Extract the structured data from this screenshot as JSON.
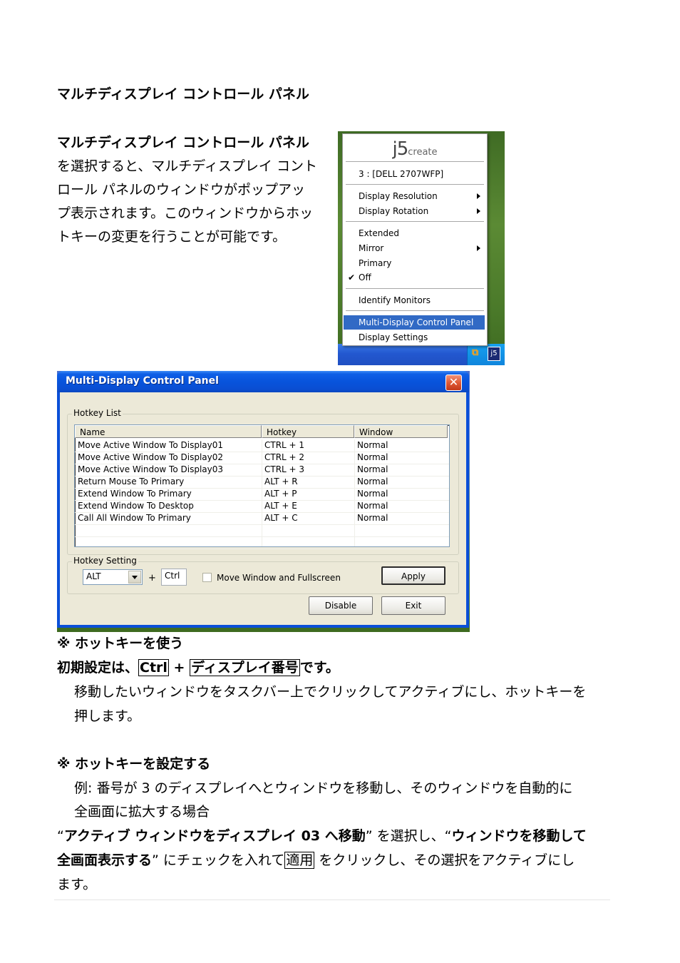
{
  "document": {
    "heading": "マルチディスプレイ コントロール パネル",
    "intro": {
      "bold_lead": "マルチディスプレイ コントロール パネル",
      "lines": [
        "を選択すると、マルチディスプレイ コント",
        "ロール パネルのウィンドウがポップアッ",
        "プ表示されます。このウィンドウからホッ",
        "トキーの変更を行うことが可能です。"
      ]
    },
    "section_use": {
      "title": "※ ホットキーを使う",
      "default_prefix": "初期設定は、",
      "default_key1": "Ctrl",
      "default_plus": " + ",
      "default_key2": "ディスプレイ番号",
      "default_suffix": "です。",
      "body_lines": [
        "移動したいウィンドウをタスクバー上でクリックしてアクティブにし、ホットキーを",
        "押します。"
      ]
    },
    "section_set": {
      "title": "※ ホットキーを設定する",
      "example_lines": [
        "例: 番号が 3 のディスプレイへとウィンドウを移動し、そのウィンドウを自動的に",
        "全画面に拡大する場合"
      ],
      "q1_open": "“",
      "q1_bold": "アクティブ ウィンドウをディスプレイ 03 へ移動",
      "q1_close": "” を選択し、“",
      "q2_bold_a": "ウィンドウを移動して",
      "q2_bold_b": "全画面表示する",
      "q2_close": "” にチェックを入れて",
      "apply_boxed": "適用",
      "after_apply": " をクリックし、その選択をアクティブにし",
      "last_line": "ます。"
    }
  },
  "context_menu": {
    "logo_main": "j5",
    "logo_sub": "create",
    "monitor": "3 : [DELL 2707WFP]",
    "items": [
      {
        "label": "Display Resolution",
        "submenu": true
      },
      {
        "label": "Display Rotation",
        "submenu": true
      },
      {
        "label": "Extended",
        "submenu": false
      },
      {
        "label": "Mirror",
        "submenu": true
      },
      {
        "label": "Primary",
        "submenu": false
      },
      {
        "label": "Off",
        "checked": true
      },
      {
        "label": "Identify Monitors"
      },
      {
        "label": "Multi-Display Control Panel",
        "selected": true
      },
      {
        "label": "Display Settings"
      }
    ],
    "tray_icons": [
      "office-icon",
      "j5-monitor-icon"
    ],
    "selection_color": "#316ac5"
  },
  "dialog": {
    "title": "Multi-Display Control Panel",
    "close_glyph": "✕",
    "hotkey_list": {
      "group_label": "Hotkey List",
      "columns": [
        "Name",
        "Hotkey",
        "Window"
      ],
      "rows": [
        [
          "Move Active Window To Display01",
          "CTRL + 1",
          "Normal"
        ],
        [
          "Move Active Window To Display02",
          "CTRL + 2",
          "Normal"
        ],
        [
          "Move Active Window To Display03",
          "CTRL + 3",
          "Normal"
        ],
        [
          "Return Mouse To Primary",
          "ALT + R",
          "Normal"
        ],
        [
          "Extend Window To Primary",
          "ALT + P",
          "Normal"
        ],
        [
          "Extend Window To Desktop",
          "ALT + E",
          "Normal"
        ],
        [
          "Call All Window To Primary",
          "ALT + C",
          "Normal"
        ]
      ]
    },
    "hotkey_setting": {
      "group_label": "Hotkey Setting",
      "modifier_selected": "ALT",
      "plus": "+",
      "key_value": "Ctrl",
      "checkbox_label": "Move Window and Fullscreen",
      "checkbox_checked": false,
      "apply_label": "Apply"
    },
    "disable_label": "Disable",
    "exit_label": "Exit",
    "titlebar_color": "#0854dc",
    "client_color": "#ece9d8"
  }
}
